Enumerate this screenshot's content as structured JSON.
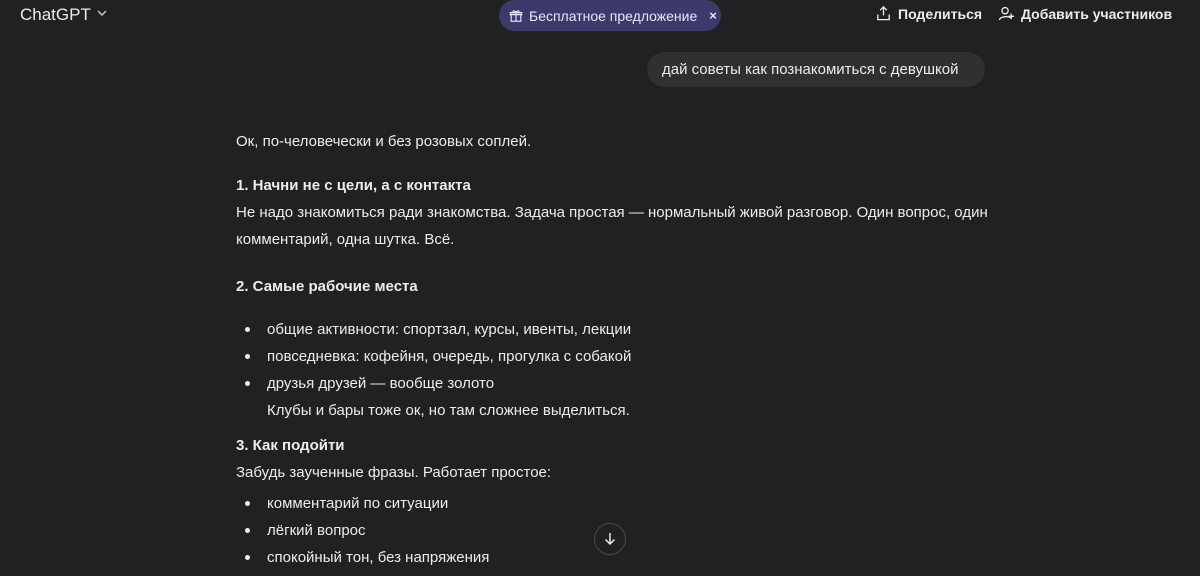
{
  "header": {
    "brand": "ChatGPT",
    "offer_label": "Бесплатное предложение",
    "offer_close": "×",
    "share_label": "Поделиться",
    "add_members_label": "Добавить участников"
  },
  "icons": {
    "brand_chevron": "chevron-down-icon",
    "offer_gift": "gift-icon",
    "share": "share-icon",
    "add_members": "add-person-icon",
    "scroll_down": "arrow-down-icon"
  },
  "colors": {
    "background": "#212121",
    "offer_pill": "#3b3a6b",
    "user_bubble": "#303030",
    "text": "#ececec"
  },
  "user_message": "дай советы как познакомиться с девушкой",
  "answer": {
    "intro": "Ок, по-человечески и без розовых соплей.",
    "s1_title": "1. Начни не с цели, а с контакта",
    "s1_text": "Не надо знакомиться ради знакомства. Задача простая — нормальный живой разговор. Один вопрос, один комментарий, одна шутка. Всё.",
    "s2_title": "2. Самые рабочие места",
    "s2_items": [
      "общие активности: спортзал, курсы, ивенты, лекции",
      "повседневка: кофейня, очередь, прогулка с собакой",
      "друзья друзей — вообще золото"
    ],
    "s2_note": "Клубы и бары тоже ок, но там сложнее выделиться.",
    "s3_title": "3. Как подойти",
    "s3_text": "Забудь заученные фразы. Работает простое:",
    "s3_items": [
      "комментарий по ситуации",
      "лёгкий вопрос",
      "спокойный тон, без напряжения"
    ]
  }
}
